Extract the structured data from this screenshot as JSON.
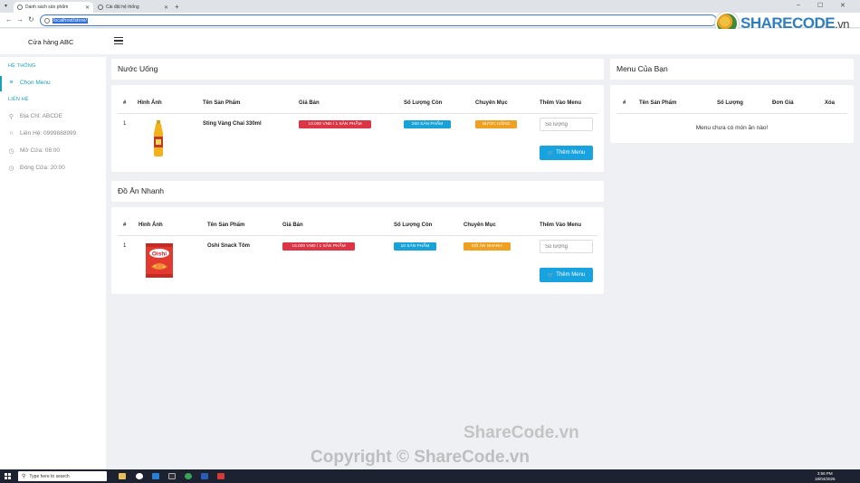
{
  "browser": {
    "tabs": [
      {
        "label": "Danh sách sản phẩm",
        "active": true
      },
      {
        "label": "Cài đặt hệ thống",
        "active": false
      }
    ],
    "url": "localhost/store/"
  },
  "overlay": {
    "logo_text": "SHARECODE",
    "logo_suffix": ".vn",
    "watermark_top": "ShareCode.vn",
    "watermark_bottom": "Copyright © ShareCode.vn"
  },
  "header": {
    "brand": "Cửa hàng ABC"
  },
  "sidebar": {
    "section1": "HỆ THỐNG",
    "menu_item": "Chọn Menu",
    "section2": "LIÊN HỆ",
    "contacts": [
      {
        "label": "Địa Chỉ: ABCDE",
        "icon": "location-icon"
      },
      {
        "label": "Liên Hệ: 0999888999",
        "icon": "headset-icon"
      },
      {
        "label": "Mở Cửa: 08:00",
        "icon": "clock-icon"
      },
      {
        "label": "Đóng Cửa: 20:00",
        "icon": "clock-icon"
      }
    ]
  },
  "columns": {
    "index": "#",
    "image": "Hình Ảnh",
    "name": "Tên Sản Phẩm",
    "price": "Giá Bán",
    "stock": "Số Lượng Còn",
    "category": "Chuyên Mục",
    "add": "Thêm Vào Menu"
  },
  "drinks": {
    "title": "Nước Uống",
    "row": {
      "index": "1",
      "name": "Sting Vàng Chai 330ml",
      "price": "10.000 VNĐ / 1 SẢN PHẨM",
      "stock": "260 SẢN PHẨM",
      "category": "NƯỚC UỐNG",
      "qty_placeholder": "Số lượng",
      "add_label": "Thêm Menu"
    }
  },
  "fastfood": {
    "title": "Đồ Ăn Nhanh",
    "row": {
      "index": "1",
      "name": "Oshi Snack Tôm",
      "price": "15.000 VNĐ / 1 SẢN PHẨM",
      "stock": "10 SẢN PHẨM",
      "category": "ĐỒ ĂN NHANH",
      "qty_placeholder": "Số lượng",
      "add_label": "Thêm Menu",
      "snack_brand": "Oishi"
    }
  },
  "menu": {
    "title": "Menu Của Bạn",
    "columns": {
      "index": "#",
      "name": "Tên Sản Phẩm",
      "qty": "Số Lượng",
      "unit_price": "Đơn Giá",
      "delete": "Xóa"
    },
    "empty": "Menu chưa có món ăn nào!"
  },
  "taskbar": {
    "search_placeholder": "Type here to search",
    "time": "3:56 PM",
    "date": "18/04/2025"
  },
  "colors": {
    "accent": "#17a2b8",
    "price_badge": "#dc3545",
    "stock_badge": "#17a2d8",
    "category_badge": "#f0a020",
    "add_button": "#17a2e0"
  }
}
